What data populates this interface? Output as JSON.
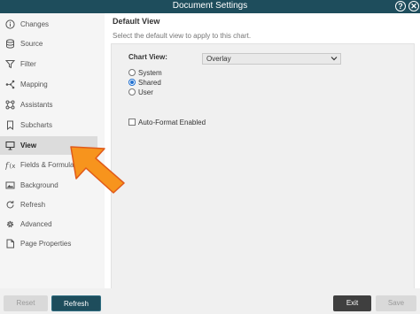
{
  "window": {
    "title": "Document Settings",
    "help_glyph": "?",
    "close_glyph": "✕"
  },
  "sidebar": {
    "items": [
      {
        "label": "Changes",
        "icon": "info-icon"
      },
      {
        "label": "Source",
        "icon": "database-icon"
      },
      {
        "label": "Filter",
        "icon": "filter-icon"
      },
      {
        "label": "Mapping",
        "icon": "mapping-icon"
      },
      {
        "label": "Assistants",
        "icon": "assistants-icon"
      },
      {
        "label": "Subcharts",
        "icon": "bookmark-icon"
      },
      {
        "label": "View",
        "icon": "monitor-icon",
        "active": true
      },
      {
        "label": "Fields & Formulas",
        "icon": "function-icon"
      },
      {
        "label": "Background",
        "icon": "image-icon"
      },
      {
        "label": "Refresh",
        "icon": "refresh-icon"
      },
      {
        "label": "Advanced",
        "icon": "gear-icon"
      },
      {
        "label": "Page Properties",
        "icon": "page-icon"
      }
    ]
  },
  "main": {
    "heading": "Default View",
    "subtitle": "Select the default view to apply to this chart.",
    "chart_view_label": "Chart View:",
    "chart_view_value": "Overlay",
    "radios": [
      {
        "label": "System",
        "selected": false
      },
      {
        "label": "Shared",
        "selected": true
      },
      {
        "label": "User",
        "selected": false
      }
    ],
    "auto_format_label": "Auto-Format Enabled",
    "auto_format_checked": false
  },
  "footer": {
    "reset_label": "Reset",
    "refresh_label": "Refresh",
    "exit_label": "Exit",
    "save_label": "Save"
  },
  "colors": {
    "titlebar": "#1e4d5c",
    "arrow_fill": "#f7941d",
    "arrow_stroke": "#e05a1a",
    "accent": "#1f6fd0"
  }
}
